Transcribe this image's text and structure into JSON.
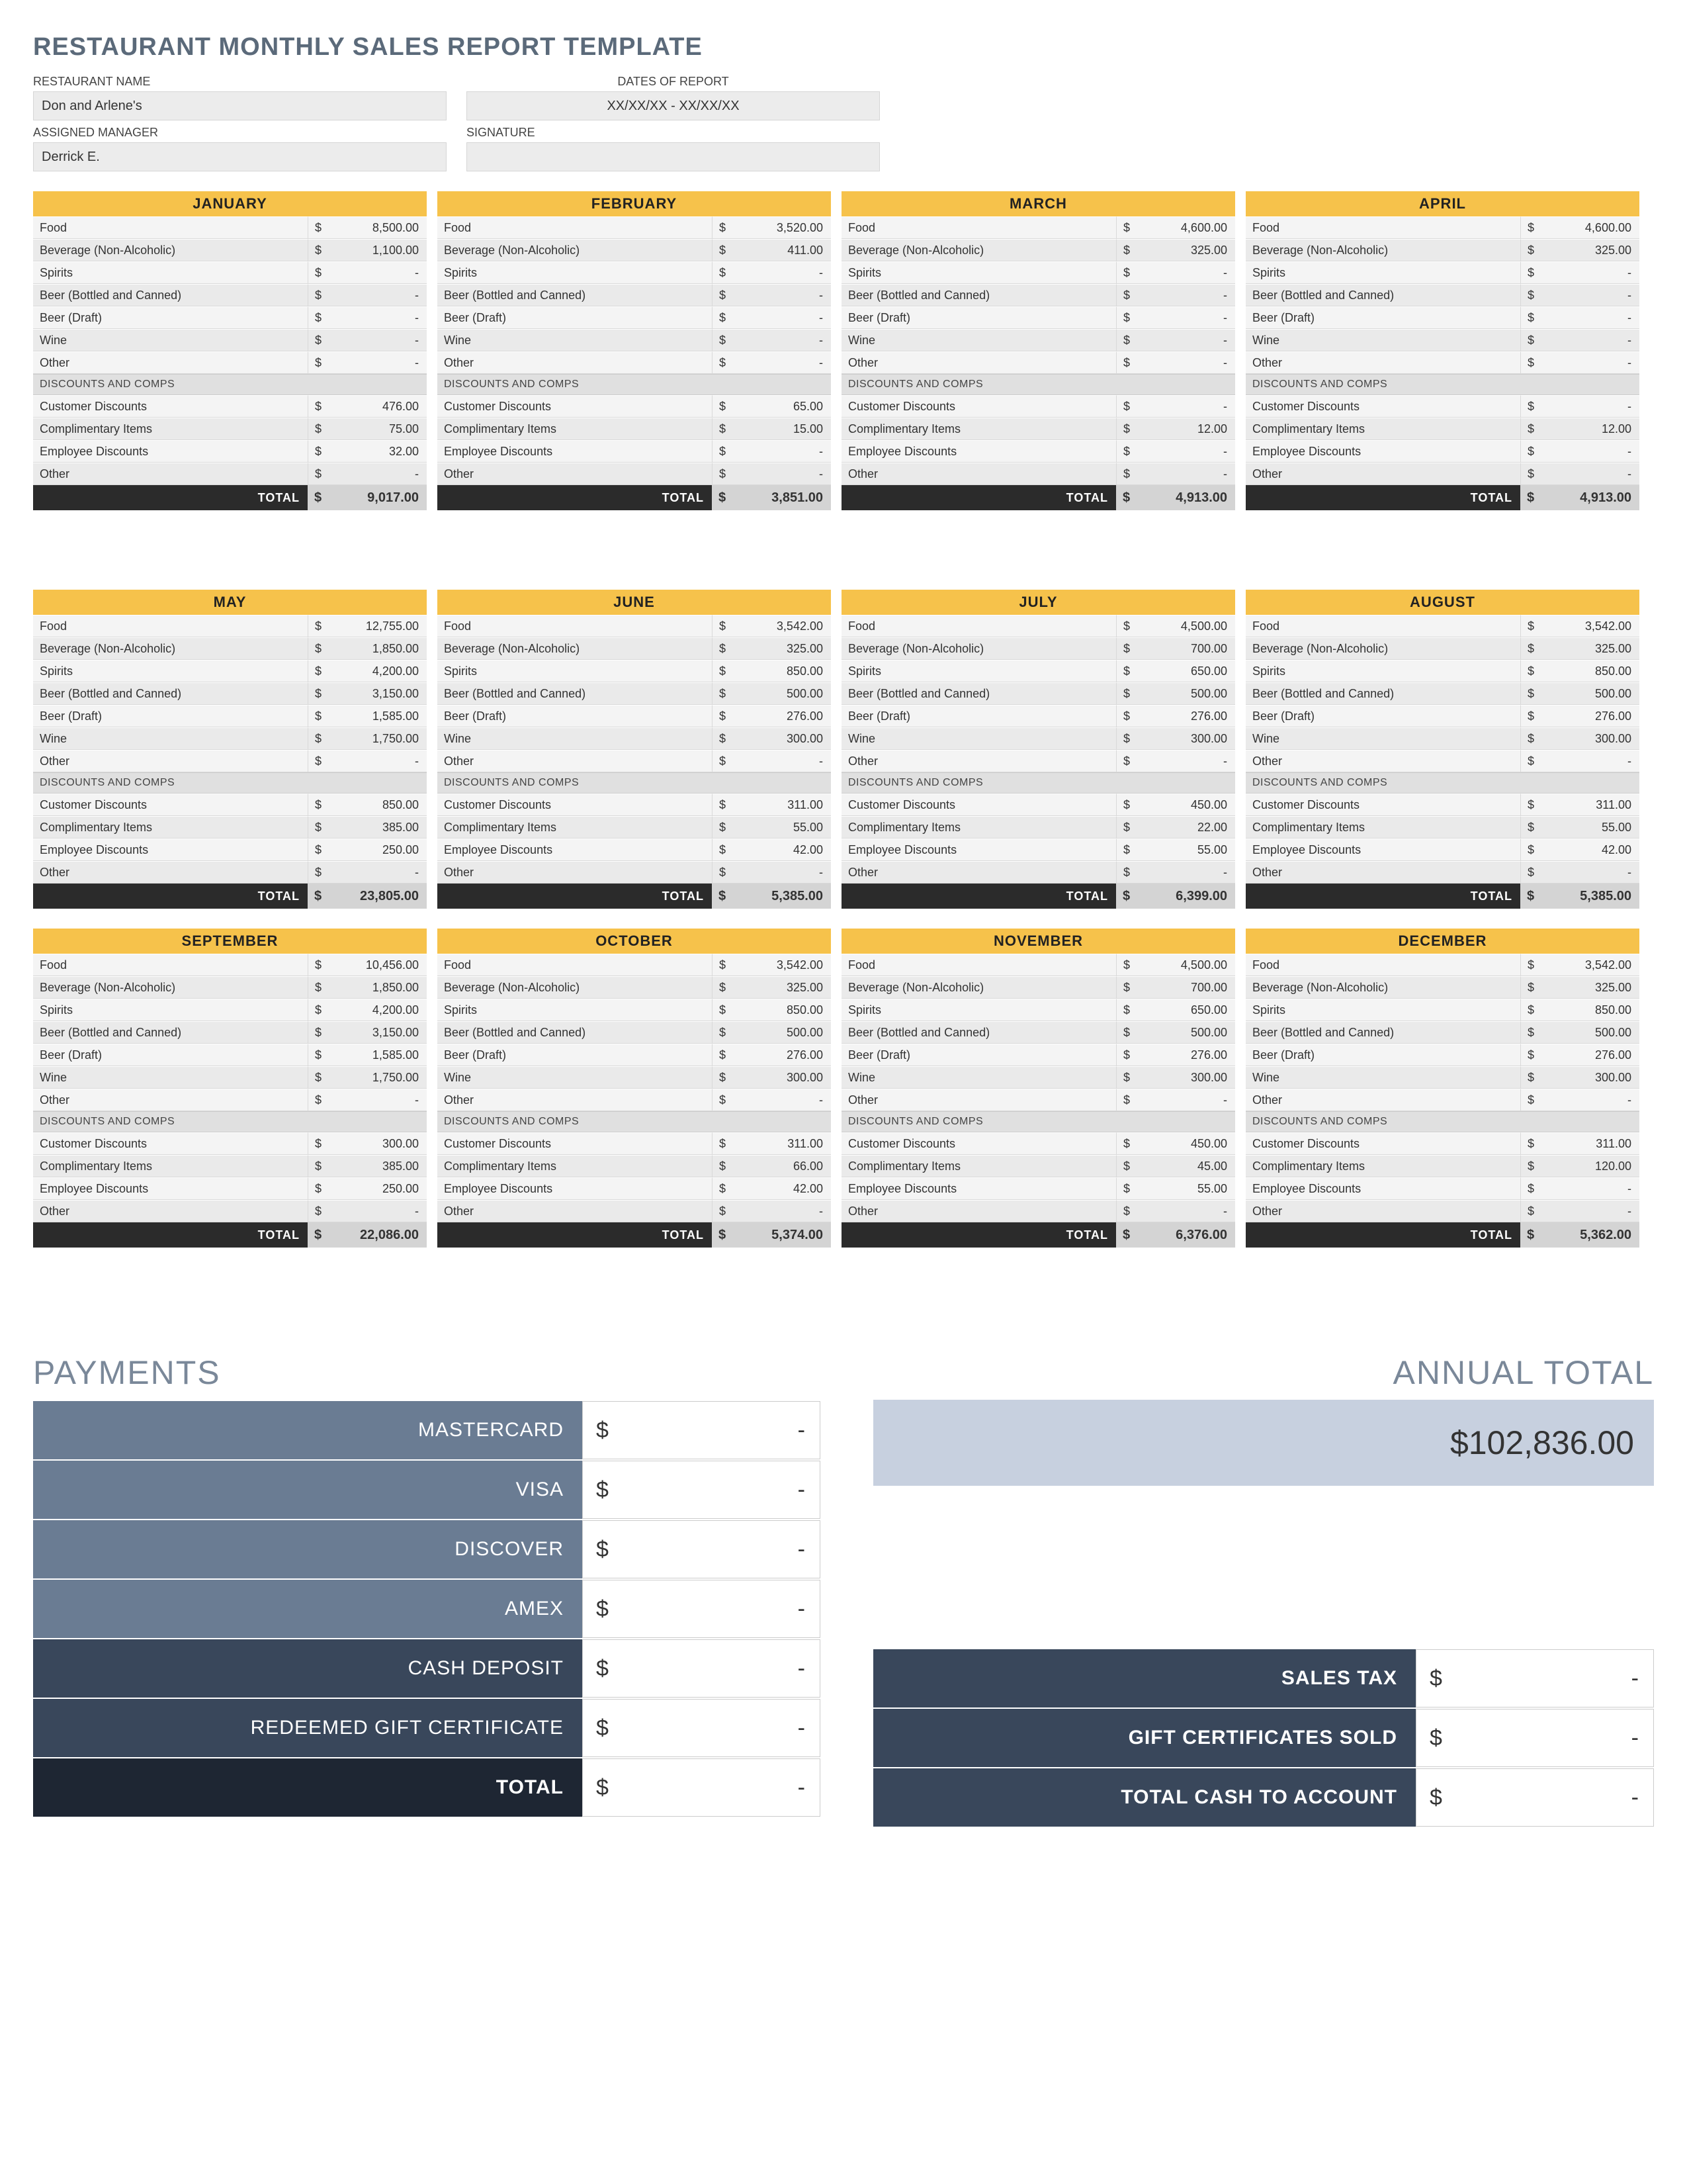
{
  "title": "RESTAURANT MONTHLY SALES REPORT TEMPLATE",
  "header": {
    "restaurant_name_label": "RESTAURANT NAME",
    "restaurant_name": "Don and Arlene's",
    "dates_label": "DATES OF REPORT",
    "dates": "XX/XX/XX - XX/XX/XX",
    "manager_label": "ASSIGNED MANAGER",
    "manager": "Derrick E.",
    "signature_label": "SIGNATURE",
    "signature": ""
  },
  "sales_labels": [
    "Food",
    "Beverage (Non-Alcoholic)",
    "Spirits",
    "Beer (Bottled and Canned)",
    "Beer (Draft)",
    "Wine",
    "Other"
  ],
  "disc_header": "DISCOUNTS AND COMPS",
  "disc_labels": [
    "Customer Discounts",
    "Complimentary Items",
    "Employee Discounts",
    "Other"
  ],
  "total_label": "TOTAL",
  "dollar": "$",
  "dash": "-",
  "months": [
    {
      "name": "JANUARY",
      "sales": [
        "8,500.00",
        "1,100.00",
        "-",
        "-",
        "-",
        "-",
        "-"
      ],
      "disc": [
        "476.00",
        "75.00",
        "32.00",
        "-"
      ],
      "total": "9,017.00"
    },
    {
      "name": "FEBRUARY",
      "sales": [
        "3,520.00",
        "411.00",
        "-",
        "-",
        "-",
        "-",
        "-"
      ],
      "disc": [
        "65.00",
        "15.00",
        "-",
        "-"
      ],
      "total": "3,851.00"
    },
    {
      "name": "MARCH",
      "sales": [
        "4,600.00",
        "325.00",
        "-",
        "-",
        "-",
        "-",
        "-"
      ],
      "disc": [
        "-",
        "12.00",
        "-",
        "-"
      ],
      "total": "4,913.00"
    },
    {
      "name": "APRIL",
      "sales": [
        "4,600.00",
        "325.00",
        "-",
        "-",
        "-",
        "-",
        "-"
      ],
      "disc": [
        "-",
        "12.00",
        "-",
        "-"
      ],
      "total": "4,913.00"
    },
    {
      "name": "MAY",
      "sales": [
        "12,755.00",
        "1,850.00",
        "4,200.00",
        "3,150.00",
        "1,585.00",
        "1,750.00",
        "-"
      ],
      "disc": [
        "850.00",
        "385.00",
        "250.00",
        "-"
      ],
      "total": "23,805.00"
    },
    {
      "name": "JUNE",
      "sales": [
        "3,542.00",
        "325.00",
        "850.00",
        "500.00",
        "276.00",
        "300.00",
        "-"
      ],
      "disc": [
        "311.00",
        "55.00",
        "42.00",
        "-"
      ],
      "total": "5,385.00"
    },
    {
      "name": "JULY",
      "sales": [
        "4,500.00",
        "700.00",
        "650.00",
        "500.00",
        "276.00",
        "300.00",
        "-"
      ],
      "disc": [
        "450.00",
        "22.00",
        "55.00",
        "-"
      ],
      "total": "6,399.00"
    },
    {
      "name": "AUGUST",
      "sales": [
        "3,542.00",
        "325.00",
        "850.00",
        "500.00",
        "276.00",
        "300.00",
        "-"
      ],
      "disc": [
        "311.00",
        "55.00",
        "42.00",
        "-"
      ],
      "total": "5,385.00"
    },
    {
      "name": "SEPTEMBER",
      "sales": [
        "10,456.00",
        "1,850.00",
        "4,200.00",
        "3,150.00",
        "1,585.00",
        "1,750.00",
        "-"
      ],
      "disc": [
        "300.00",
        "385.00",
        "250.00",
        "-"
      ],
      "total": "22,086.00"
    },
    {
      "name": "OCTOBER",
      "sales": [
        "3,542.00",
        "325.00",
        "850.00",
        "500.00",
        "276.00",
        "300.00",
        "-"
      ],
      "disc": [
        "311.00",
        "66.00",
        "42.00",
        "-"
      ],
      "total": "5,374.00"
    },
    {
      "name": "NOVEMBER",
      "sales": [
        "4,500.00",
        "700.00",
        "650.00",
        "500.00",
        "276.00",
        "300.00",
        "-"
      ],
      "disc": [
        "450.00",
        "45.00",
        "55.00",
        "-"
      ],
      "total": "6,376.00"
    },
    {
      "name": "DECEMBER",
      "sales": [
        "3,542.00",
        "325.00",
        "850.00",
        "500.00",
        "276.00",
        "300.00",
        "-"
      ],
      "disc": [
        "311.00",
        "120.00",
        "-",
        "-"
      ],
      "total": "5,362.00"
    }
  ],
  "payments": {
    "title": "PAYMENTS",
    "rows": [
      {
        "label": "MASTERCARD",
        "value": "-"
      },
      {
        "label": "VISA",
        "value": "-"
      },
      {
        "label": "DISCOVER",
        "value": "-"
      },
      {
        "label": "AMEX",
        "value": "-"
      },
      {
        "label": "CASH DEPOSIT",
        "value": "-"
      },
      {
        "label": "REDEEMED GIFT CERTIFICATE",
        "value": "-"
      }
    ],
    "total_label": "TOTAL",
    "total_value": "-"
  },
  "annual": {
    "title": "ANNUAL TOTAL",
    "value": "$102,836.00"
  },
  "summary": [
    {
      "label": "SALES TAX",
      "value": "-"
    },
    {
      "label": "GIFT CERTIFICATES SOLD",
      "value": "-"
    },
    {
      "label": "TOTAL CASH TO ACCOUNT",
      "value": "-"
    }
  ]
}
